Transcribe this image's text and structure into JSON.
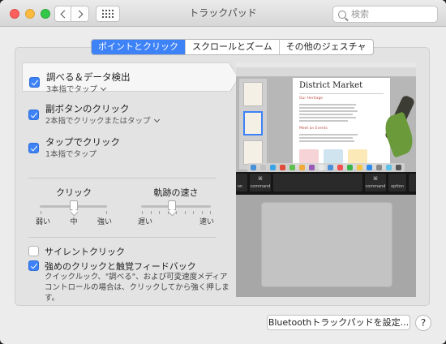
{
  "window": {
    "title": "トラックパッド"
  },
  "search": {
    "placeholder": "検索"
  },
  "tabs": [
    {
      "label": "ポイントとクリック",
      "active": true
    },
    {
      "label": "スクロールとズーム",
      "active": false
    },
    {
      "label": "その他のジェスチャ",
      "active": false
    }
  ],
  "gestures": [
    {
      "title": "調べる＆データ検出",
      "subtitle": "3本指でタップ",
      "checked": true,
      "selected": true
    },
    {
      "title": "副ボタンのクリック",
      "subtitle": "2本指でクリックまたはタップ",
      "checked": true,
      "selected": false
    },
    {
      "title": "タップでクリック",
      "subtitle": "1本指でタップ",
      "checked": true,
      "selected": false
    }
  ],
  "click_slider": {
    "label": "クリック",
    "min_label": "弱い",
    "mid_label": "中",
    "max_label": "強い",
    "value": 0.5
  },
  "speed_slider": {
    "label": "軌跡の速さ",
    "min_label": "遅い",
    "max_label": "速い",
    "value": 0.44
  },
  "options": [
    {
      "label": "サイレントクリック",
      "checked": false
    },
    {
      "label": "強めのクリックと触覚フィードバック",
      "checked": true
    }
  ],
  "force_click_description": "クイックルック、\"調べる\"、および可変速度メディアコントロールの場合は、クリックしてから強く押します。",
  "preview": {
    "doc_title": "District Market",
    "section1": "Our Heritage",
    "section2": "Meet an Events",
    "keys": {
      "left_sym": "⌘",
      "left_word": "command",
      "right_sym": "⌘",
      "right_word": "command",
      "option_word": "option",
      "far_left_word": "on"
    }
  },
  "bluetooth_button": "Bluetoothトラックパッドを設定...",
  "help_button": "?",
  "colors": {
    "accent": "#3e82f7"
  }
}
